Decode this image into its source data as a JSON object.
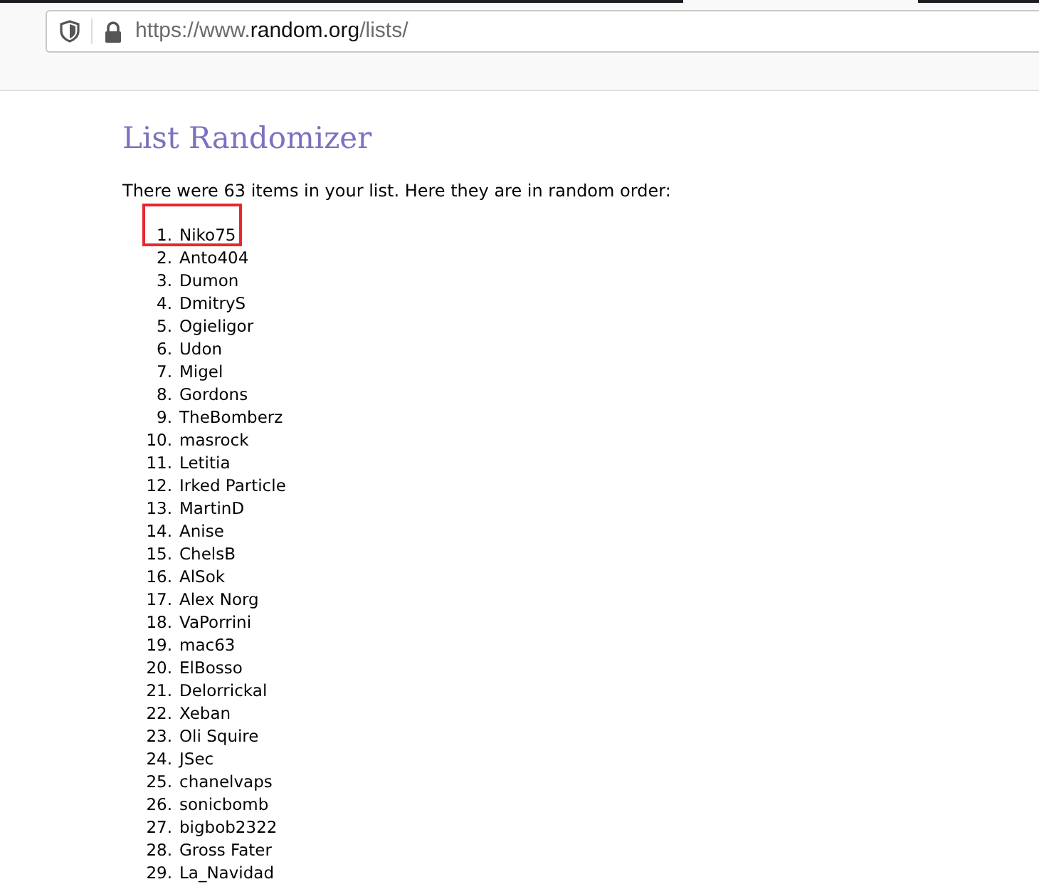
{
  "browser": {
    "url": {
      "scheme": "https://www.",
      "domain": "random.org",
      "path": "/lists/"
    }
  },
  "page": {
    "title": "List Randomizer",
    "intro": "There were 63 items in your list. Here they are in random order:",
    "items": [
      {
        "number": "1.",
        "name": "Niko75",
        "highlighted": true
      },
      {
        "number": "2.",
        "name": "Anto404",
        "highlighted": false
      },
      {
        "number": "3.",
        "name": "Dumon",
        "highlighted": false
      },
      {
        "number": "4.",
        "name": "DmitryS",
        "highlighted": false
      },
      {
        "number": "5.",
        "name": "Ogieligor",
        "highlighted": false
      },
      {
        "number": "6.",
        "name": "Udon",
        "highlighted": false
      },
      {
        "number": "7.",
        "name": "Migel",
        "highlighted": false
      },
      {
        "number": "8.",
        "name": "Gordons",
        "highlighted": false
      },
      {
        "number": "9.",
        "name": "TheBomberz",
        "highlighted": false
      },
      {
        "number": "10.",
        "name": "masrock",
        "highlighted": false
      },
      {
        "number": "11.",
        "name": "Letitia",
        "highlighted": false
      },
      {
        "number": "12.",
        "name": "Irked Particle",
        "highlighted": false
      },
      {
        "number": "13.",
        "name": "MartinD",
        "highlighted": false
      },
      {
        "number": "14.",
        "name": "Anise",
        "highlighted": false
      },
      {
        "number": "15.",
        "name": "ChelsB",
        "highlighted": false
      },
      {
        "number": "16.",
        "name": "AlSok",
        "highlighted": false
      },
      {
        "number": "17.",
        "name": "Alex Norg",
        "highlighted": false
      },
      {
        "number": "18.",
        "name": "VaPorrini",
        "highlighted": false
      },
      {
        "number": "19.",
        "name": "mac63",
        "highlighted": false
      },
      {
        "number": "20.",
        "name": "ElBosso",
        "highlighted": false
      },
      {
        "number": "21.",
        "name": "Delorrickal",
        "highlighted": false
      },
      {
        "number": "22.",
        "name": "Xeban",
        "highlighted": false
      },
      {
        "number": "23.",
        "name": "Oli Squire",
        "highlighted": false
      },
      {
        "number": "24.",
        "name": "JSec",
        "highlighted": false
      },
      {
        "number": "25.",
        "name": "chanelvaps",
        "highlighted": false
      },
      {
        "number": "26.",
        "name": "sonicbomb",
        "highlighted": false
      },
      {
        "number": "27.",
        "name": "bigbob2322",
        "highlighted": false
      },
      {
        "number": "28.",
        "name": "Gross Fater",
        "highlighted": false
      },
      {
        "number": "29.",
        "name": "La_Navidad",
        "highlighted": false
      }
    ]
  }
}
